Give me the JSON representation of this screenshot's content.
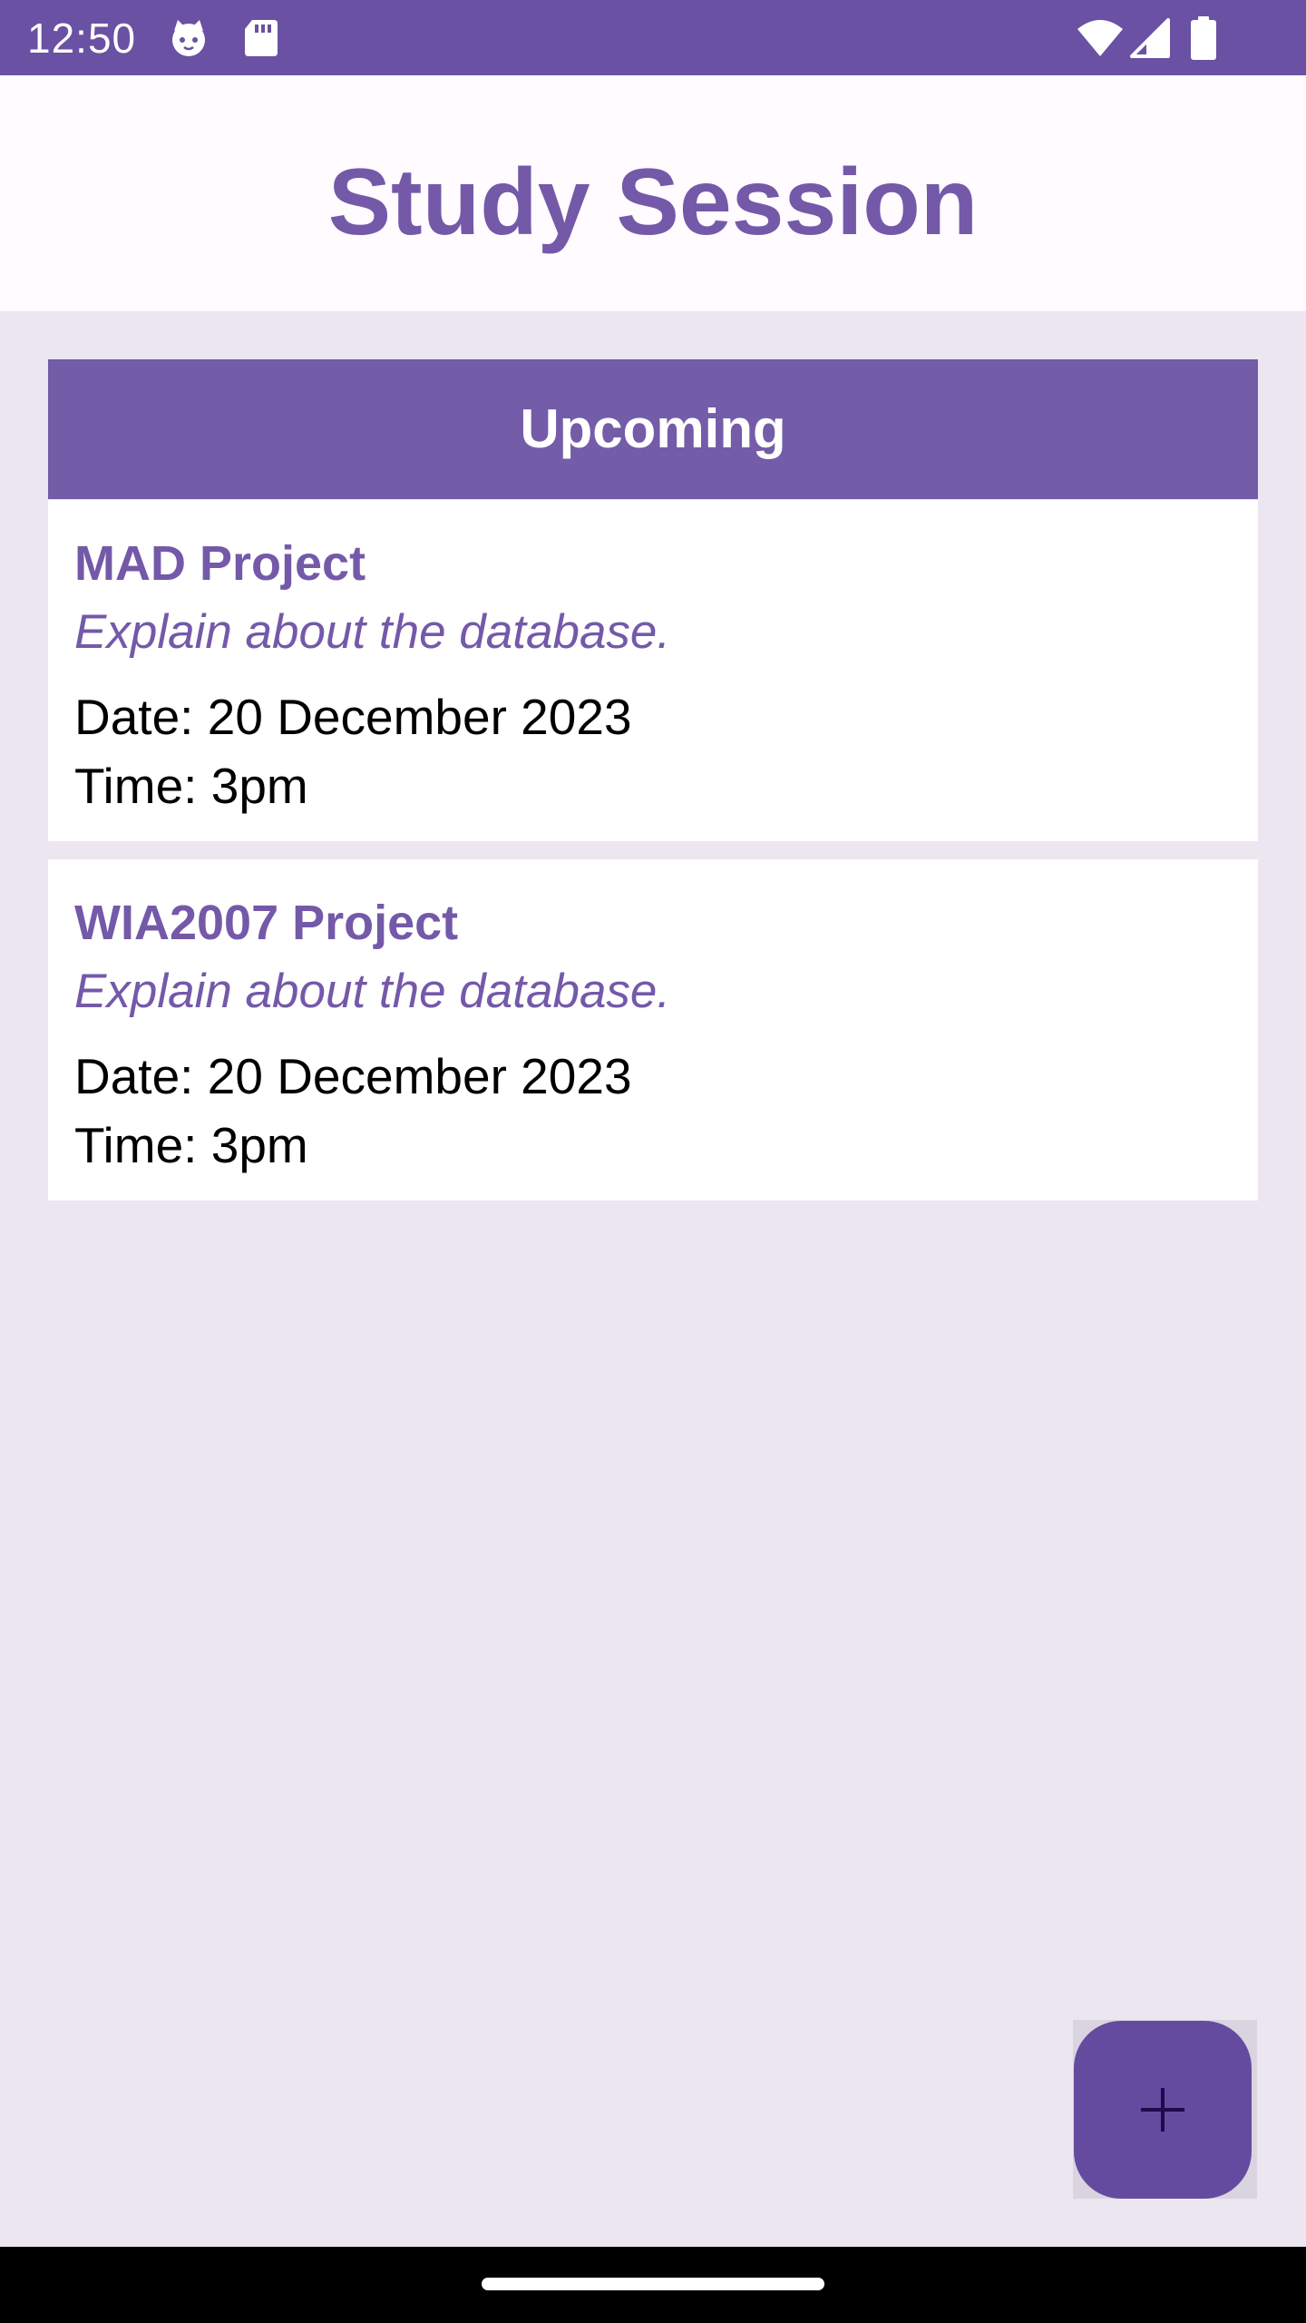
{
  "status_bar": {
    "time": "12:50",
    "icons_left": [
      "cat-icon",
      "sd-card-icon"
    ],
    "icons_right": [
      "wifi-icon",
      "signal-icon",
      "battery-icon"
    ],
    "color": "#6a51a3"
  },
  "app_bar": {
    "title": "Study Session",
    "title_color": "#7459a9"
  },
  "section": {
    "header": "Upcoming",
    "header_color": "#735ca8"
  },
  "sessions": [
    {
      "title": "MAD Project",
      "description": "Explain about the database.",
      "date": "Date: 20 December 2023",
      "time": "Time: 3pm"
    },
    {
      "title": "WIA2007 Project",
      "description": "Explain about the database.",
      "date": "Date: 20 December 2023",
      "time": "Time: 3pm"
    }
  ],
  "fab": {
    "icon": "plus-icon",
    "color": "#654b9f"
  },
  "background_color": "#ece6f1"
}
